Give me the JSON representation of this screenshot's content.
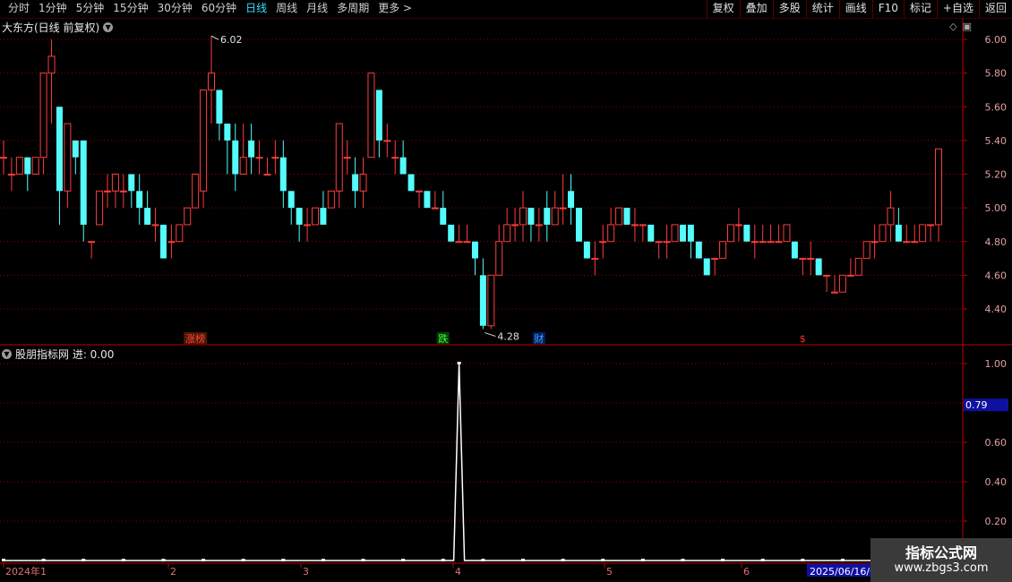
{
  "toolbar": {
    "tabs": [
      "分时",
      "1分钟",
      "5分钟",
      "15分钟",
      "30分钟",
      "60分钟",
      "日线",
      "周线",
      "月线",
      "多周期",
      "更多 >"
    ],
    "active_tab": "日线",
    "tools": [
      "复权",
      "叠加",
      "多股",
      "统计",
      "画线",
      "F10",
      "标记",
      "+自选",
      "返回"
    ]
  },
  "main_title": "大东方(日线 前复权)",
  "indicator_title": "股朋指标网 进: 0.00",
  "markers": {
    "high_label": "6.02",
    "low_label": "4.28",
    "events": [
      {
        "text": "涨榜",
        "color": "#ff4040",
        "bg": "#4a1a00",
        "idx": 24
      },
      {
        "text": "跌",
        "color": "#40ff40",
        "bg": "#004000",
        "idx": 55
      },
      {
        "text": "财",
        "color": "#40a0ff",
        "bg": "#002060",
        "idx": 67
      },
      {
        "text": "$",
        "color": "#ff3030",
        "bg": "#000000",
        "idx": 100
      }
    ]
  },
  "price_axis": {
    "labels": [
      "6.00",
      "5.80",
      "5.60",
      "5.40",
      "5.20",
      "5.00",
      "4.80",
      "4.60",
      "4.40"
    ]
  },
  "indicator_axis": {
    "labels": [
      "1.00",
      "0.80",
      "0.60",
      "0.40",
      "0.20"
    ],
    "current_value": "0.79"
  },
  "date_axis": {
    "labels": [
      "2024年1",
      "2",
      "3",
      "4",
      "5",
      "6",
      "2025/06/16/一"
    ]
  },
  "watermark": {
    "line1": "指标公式网",
    "line2": "www.zbgs3.com"
  },
  "colors": {
    "up": "#ff3c3c",
    "down": "#54fcfc",
    "grid": "#8a0000",
    "axis": "#c00000",
    "line": "#ffffff"
  },
  "chart_data": {
    "type": "candlestick",
    "y_range": [
      4.28,
      6.02
    ],
    "candles": [
      [
        5.3,
        5.4,
        5.3,
        5.2
      ],
      [
        5.2,
        5.3,
        5.2,
        5.1
      ],
      [
        5.2,
        5.3,
        5.3,
        5.2
      ],
      [
        5.3,
        5.3,
        5.2,
        5.1
      ],
      [
        5.2,
        5.3,
        5.3,
        5.2
      ],
      [
        5.3,
        5.8,
        5.8,
        5.2
      ],
      [
        5.8,
        6.0,
        5.9,
        5.5
      ],
      [
        5.6,
        5.6,
        5.1,
        4.9
      ],
      [
        5.1,
        5.5,
        5.5,
        5.0
      ],
      [
        5.4,
        5.4,
        5.3,
        5.2
      ],
      [
        5.4,
        5.4,
        4.9,
        4.8
      ],
      [
        4.8,
        4.8,
        4.8,
        4.7
      ],
      [
        4.9,
        5.1,
        5.1,
        4.9
      ],
      [
        5.1,
        5.2,
        5.1,
        5.0
      ],
      [
        5.1,
        5.2,
        5.2,
        5.0
      ],
      [
        5.1,
        5.2,
        5.1,
        5.0
      ],
      [
        5.2,
        5.2,
        5.1,
        5.0
      ],
      [
        5.1,
        5.2,
        5.0,
        4.9
      ],
      [
        5.0,
        5.1,
        4.9,
        4.9
      ],
      [
        4.9,
        5.0,
        4.9,
        4.8
      ],
      [
        4.9,
        4.9,
        4.7,
        4.7
      ],
      [
        4.8,
        4.9,
        4.8,
        4.7
      ],
      [
        4.8,
        4.9,
        4.9,
        4.8
      ],
      [
        4.9,
        5.0,
        5.0,
        4.9
      ],
      [
        5.0,
        5.2,
        5.2,
        5.0
      ],
      [
        5.1,
        5.7,
        5.7,
        5.0
      ],
      [
        5.7,
        6.02,
        5.8,
        5.5
      ],
      [
        5.7,
        5.7,
        5.5,
        5.4
      ],
      [
        5.5,
        5.5,
        5.4,
        5.2
      ],
      [
        5.4,
        5.5,
        5.2,
        5.1
      ],
      [
        5.2,
        5.5,
        5.3,
        5.2
      ],
      [
        5.4,
        5.5,
        5.3,
        5.2
      ],
      [
        5.3,
        5.4,
        5.3,
        5.2
      ],
      [
        5.2,
        5.3,
        5.2,
        5.2
      ],
      [
        5.3,
        5.4,
        5.3,
        5.2
      ],
      [
        5.3,
        5.4,
        5.1,
        5.0
      ],
      [
        5.1,
        5.1,
        5.0,
        4.9
      ],
      [
        5.0,
        5.0,
        4.9,
        4.8
      ],
      [
        4.9,
        5.0,
        4.9,
        4.8
      ],
      [
        4.9,
        5.0,
        5.0,
        4.9
      ],
      [
        5.0,
        5.1,
        4.9,
        4.9
      ],
      [
        5.0,
        5.1,
        5.1,
        5.0
      ],
      [
        5.1,
        5.5,
        5.5,
        5.0
      ],
      [
        5.3,
        5.4,
        5.3,
        5.2
      ],
      [
        5.2,
        5.3,
        5.1,
        5.0
      ],
      [
        5.1,
        5.3,
        5.2,
        5.0
      ],
      [
        5.3,
        5.8,
        5.8,
        5.3
      ],
      [
        5.7,
        5.7,
        5.4,
        5.3
      ],
      [
        5.4,
        5.5,
        5.4,
        5.3
      ],
      [
        5.3,
        5.4,
        5.3,
        5.2
      ],
      [
        5.3,
        5.4,
        5.2,
        5.2
      ],
      [
        5.2,
        5.2,
        5.1,
        5.1
      ],
      [
        5.1,
        5.1,
        5.1,
        5.0
      ],
      [
        5.1,
        5.1,
        5.0,
        5.0
      ],
      [
        5.0,
        5.1,
        5.0,
        5.0
      ],
      [
        5.0,
        5.1,
        4.9,
        4.9
      ],
      [
        4.9,
        4.9,
        4.8,
        4.8
      ],
      [
        4.8,
        4.9,
        4.8,
        4.8
      ],
      [
        4.8,
        4.9,
        4.8,
        4.8
      ],
      [
        4.8,
        4.8,
        4.7,
        4.6
      ],
      [
        4.6,
        4.7,
        4.3,
        4.28
      ],
      [
        4.3,
        4.6,
        4.6,
        4.28
      ],
      [
        4.6,
        4.9,
        4.8,
        4.6
      ],
      [
        4.8,
        5.0,
        4.9,
        4.8
      ],
      [
        4.9,
        5.0,
        4.9,
        4.8
      ],
      [
        4.9,
        5.1,
        5.0,
        4.8
      ],
      [
        5.0,
        5.0,
        4.9,
        4.8
      ],
      [
        4.9,
        5.0,
        4.9,
        4.8
      ],
      [
        5.0,
        5.1,
        4.9,
        4.8
      ],
      [
        4.9,
        5.1,
        5.0,
        4.9
      ],
      [
        5.0,
        5.2,
        5.0,
        4.9
      ],
      [
        5.1,
        5.2,
        5.0,
        4.9
      ],
      [
        5.0,
        5.0,
        4.8,
        4.8
      ],
      [
        4.8,
        4.8,
        4.7,
        4.7
      ],
      [
        4.7,
        4.8,
        4.7,
        4.6
      ],
      [
        4.8,
        4.9,
        4.8,
        4.7
      ],
      [
        4.8,
        5.0,
        4.9,
        4.8
      ],
      [
        4.9,
        5.0,
        5.0,
        4.9
      ],
      [
        5.0,
        5.0,
        4.9,
        4.9
      ],
      [
        4.9,
        5.0,
        4.9,
        4.8
      ],
      [
        4.9,
        4.9,
        4.9,
        4.8
      ],
      [
        4.9,
        4.9,
        4.8,
        4.8
      ],
      [
        4.8,
        4.8,
        4.8,
        4.7
      ],
      [
        4.8,
        4.9,
        4.8,
        4.7
      ],
      [
        4.8,
        4.9,
        4.9,
        4.8
      ],
      [
        4.9,
        4.9,
        4.8,
        4.8
      ],
      [
        4.9,
        4.9,
        4.8,
        4.7
      ],
      [
        4.8,
        4.8,
        4.7,
        4.7
      ],
      [
        4.7,
        4.7,
        4.6,
        4.6
      ],
      [
        4.7,
        4.7,
        4.7,
        4.6
      ],
      [
        4.7,
        4.8,
        4.8,
        4.7
      ],
      [
        4.8,
        4.9,
        4.9,
        4.8
      ],
      [
        4.9,
        5.0,
        4.9,
        4.8
      ],
      [
        4.9,
        4.9,
        4.8,
        4.8
      ],
      [
        4.8,
        4.9,
        4.8,
        4.7
      ],
      [
        4.8,
        4.9,
        4.8,
        4.8
      ],
      [
        4.8,
        4.9,
        4.8,
        4.8
      ],
      [
        4.8,
        4.9,
        4.8,
        4.8
      ],
      [
        4.8,
        4.9,
        4.9,
        4.8
      ],
      [
        4.8,
        4.8,
        4.7,
        4.7
      ],
      [
        4.7,
        4.7,
        4.7,
        4.6
      ],
      [
        4.7,
        4.8,
        4.7,
        4.6
      ],
      [
        4.7,
        4.7,
        4.6,
        4.6
      ],
      [
        4.6,
        4.6,
        4.6,
        4.5
      ],
      [
        4.5,
        4.6,
        4.5,
        4.5
      ],
      [
        4.5,
        4.6,
        4.6,
        4.5
      ],
      [
        4.6,
        4.7,
        4.6,
        4.6
      ],
      [
        4.6,
        4.7,
        4.7,
        4.6
      ],
      [
        4.7,
        4.8,
        4.8,
        4.7
      ],
      [
        4.8,
        4.9,
        4.8,
        4.7
      ],
      [
        4.8,
        4.9,
        4.9,
        4.8
      ],
      [
        4.9,
        5.1,
        5.0,
        4.8
      ],
      [
        4.9,
        5.0,
        4.8,
        4.8
      ],
      [
        4.8,
        4.9,
        4.8,
        4.8
      ],
      [
        4.8,
        4.9,
        4.8,
        4.8
      ],
      [
        4.8,
        4.9,
        4.9,
        4.8
      ],
      [
        4.9,
        4.9,
        4.9,
        4.8
      ],
      [
        4.9,
        5.35,
        5.35,
        4.8
      ]
    ],
    "indicator": {
      "name": "进",
      "spike_index": 57,
      "spike_value": 1.0,
      "baseline": 0.0
    }
  }
}
